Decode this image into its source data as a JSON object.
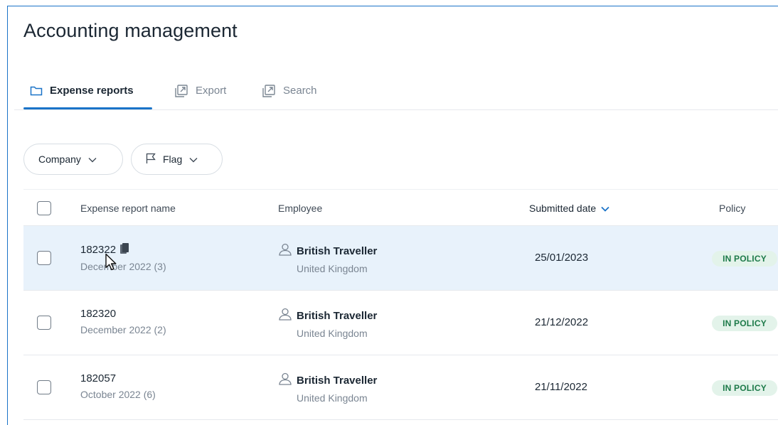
{
  "page": {
    "title": "Accounting management"
  },
  "tabs": [
    {
      "label": "Expense reports",
      "icon": "folder-icon",
      "active": true
    },
    {
      "label": "Export",
      "icon": "external-link-icon",
      "active": false
    },
    {
      "label": "Search",
      "icon": "external-link-icon",
      "active": false
    }
  ],
  "filters": {
    "company": {
      "label": "Company",
      "icon": "chevron-down-icon"
    },
    "flag": {
      "label": "Flag",
      "icon": "flag-icon"
    }
  },
  "table": {
    "columns": {
      "name": "Expense report name",
      "employee": "Employee",
      "submitted": "Submitted date",
      "policy": "Policy"
    },
    "sort": {
      "column": "submitted",
      "direction": "descending"
    },
    "rows": [
      {
        "id": "182322",
        "period": "December 2022 (3)",
        "employee": "British Traveller",
        "country": "United Kingdom",
        "date": "25/01/2023",
        "policy": "IN POLICY",
        "selected": true,
        "has_receipt_icon": true
      },
      {
        "id": "182320",
        "period": "December 2022 (2)",
        "employee": "British Traveller",
        "country": "United Kingdom",
        "date": "21/12/2022",
        "policy": "IN POLICY",
        "selected": false,
        "has_receipt_icon": false
      },
      {
        "id": "182057",
        "period": "October 2022 (6)",
        "employee": "British Traveller",
        "country": "United Kingdom",
        "date": "21/11/2022",
        "policy": "IN POLICY",
        "selected": false,
        "has_receipt_icon": false
      }
    ]
  },
  "colors": {
    "accent": "#1a73c8",
    "selected_row": "#e8f2fb",
    "badge_bg": "#e3f3ea",
    "badge_text": "#1d7a49"
  }
}
